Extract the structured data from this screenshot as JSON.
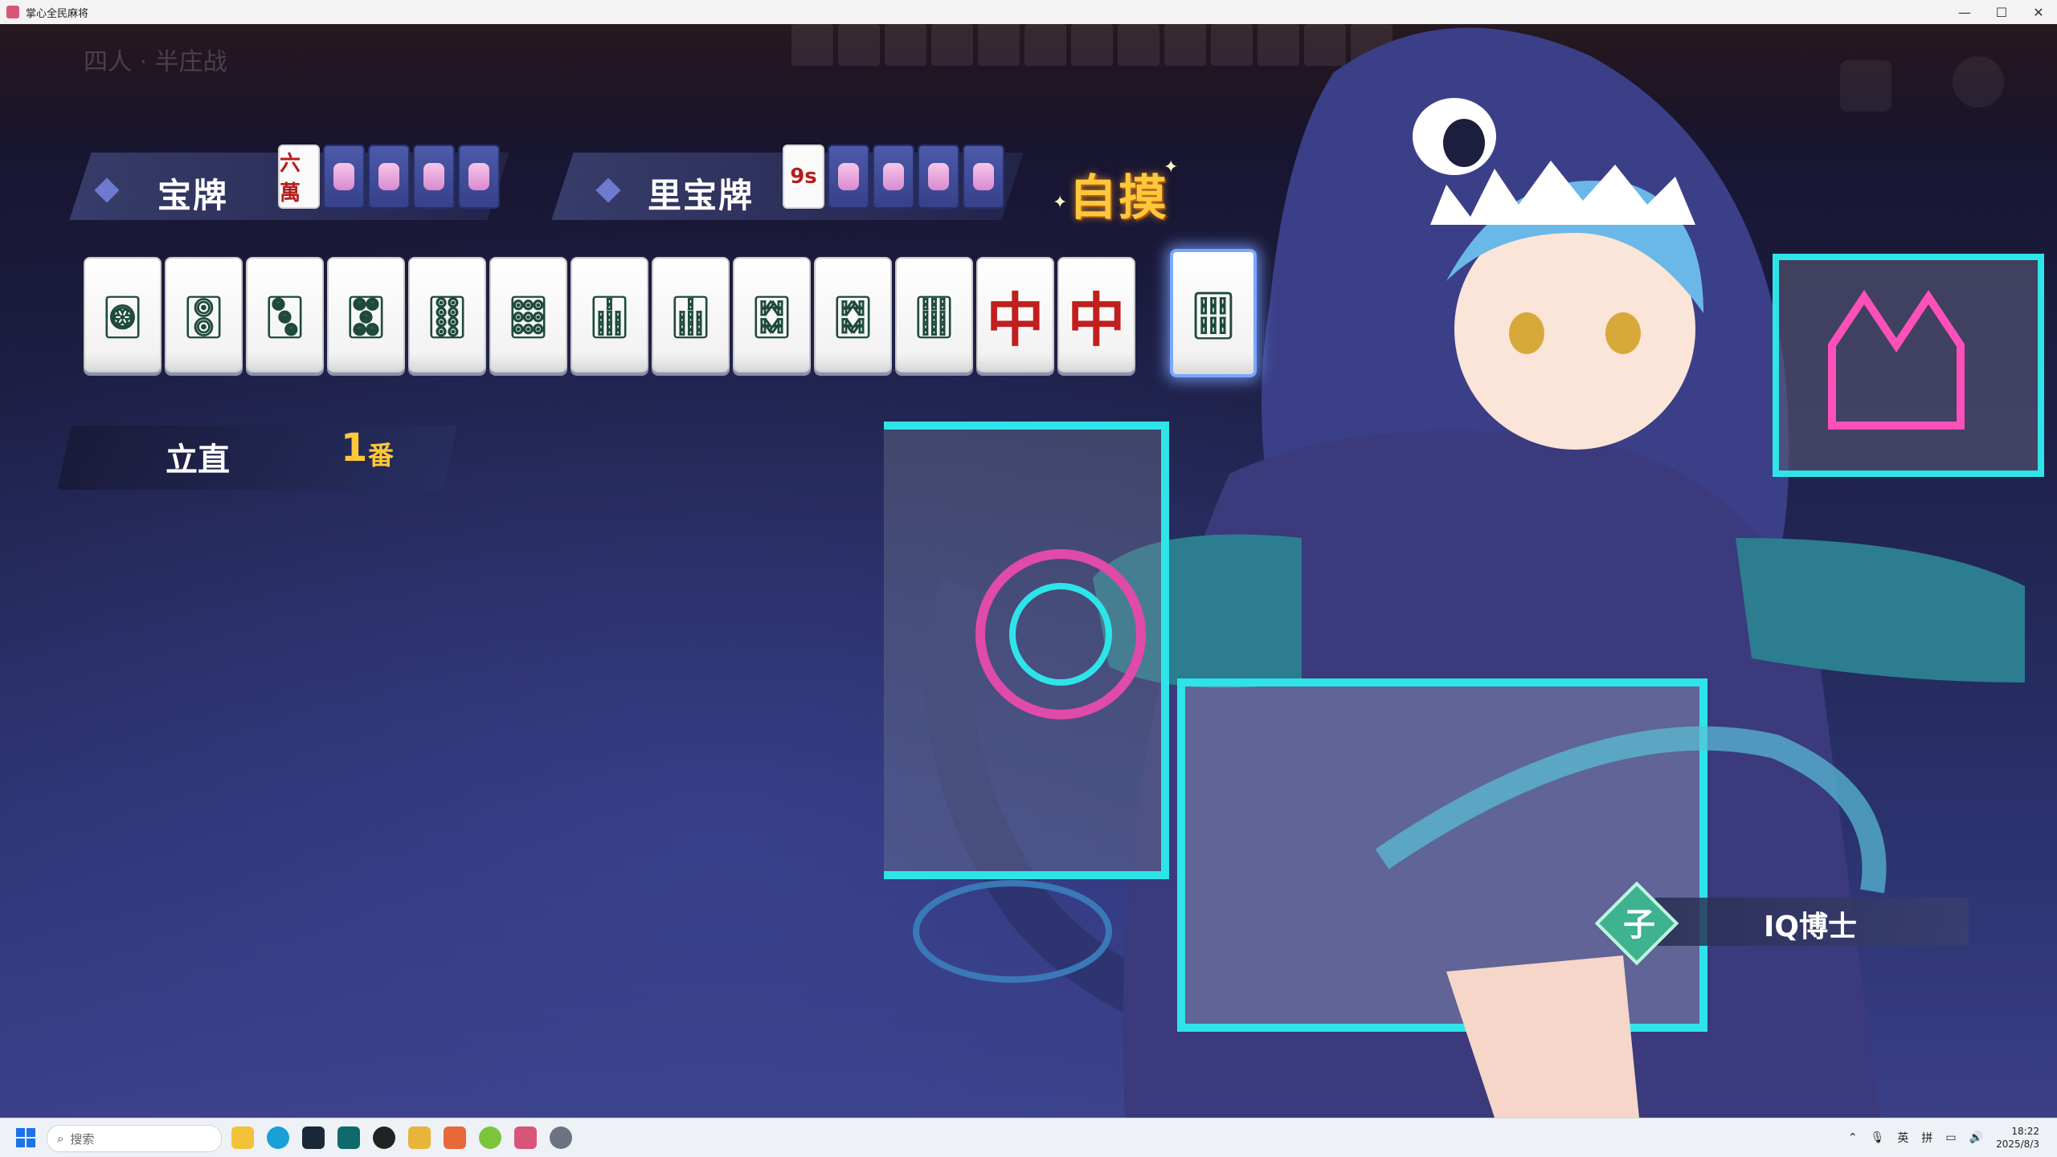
{
  "window": {
    "title": "掌心全民麻将",
    "controls": {
      "minimize": "—",
      "maximize": "☐",
      "close": "✕"
    }
  },
  "table": {
    "mode": "四人 · 半庄战"
  },
  "dora": {
    "label": "宝牌",
    "tiles": [
      "六萬",
      "back",
      "back",
      "back",
      "back"
    ]
  },
  "ura_dora": {
    "label": "里宝牌",
    "tiles": [
      "9s",
      "back",
      "back",
      "back",
      "back"
    ]
  },
  "win_type": "自摸",
  "hand": {
    "tiles": [
      {
        "id": "1p",
        "glyph": "🀙",
        "red": false
      },
      {
        "id": "2p",
        "glyph": "🀚",
        "red": false
      },
      {
        "id": "3p",
        "glyph": "🀛",
        "red": false
      },
      {
        "id": "5p",
        "glyph": "🀝",
        "red": false
      },
      {
        "id": "8p",
        "glyph": "🀠",
        "red": false
      },
      {
        "id": "9p",
        "glyph": "🀡",
        "red": false
      },
      {
        "id": "7s",
        "glyph": "🀖",
        "red": false
      },
      {
        "id": "7s",
        "glyph": "🀖",
        "red": false
      },
      {
        "id": "8s",
        "glyph": "🀗",
        "red": false
      },
      {
        "id": "8s",
        "glyph": "🀗",
        "red": false
      },
      {
        "id": "9s",
        "glyph": "🀘",
        "red": false
      },
      {
        "id": "chun",
        "glyph": "中",
        "red": true
      },
      {
        "id": "chun",
        "glyph": "中",
        "red": true
      }
    ],
    "winning_tile": {
      "id": "6s",
      "glyph": "🀕"
    }
  },
  "yaku": [
    {
      "name": "立直",
      "han": "1",
      "unit": "番"
    }
  ],
  "player": {
    "seat_badge": "子",
    "name": "IQ博士"
  },
  "taskbar": {
    "search_placeholder": "搜索",
    "search_icon": "search-icon",
    "ime": [
      "英",
      "拼"
    ],
    "time": "18:22",
    "date": "2025/8/3"
  },
  "colors": {
    "tsumo": "#ffc83a",
    "han": "#ffc83a",
    "badge": "#3fb28f",
    "win_tile_glow": "#7aa7ff"
  }
}
